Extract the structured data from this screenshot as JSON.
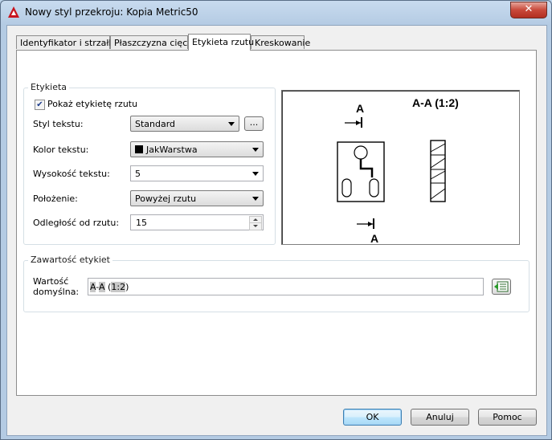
{
  "window": {
    "title": "Nowy styl przekroju: Kopia Metric50",
    "close_label": "✕"
  },
  "tabs": [
    {
      "label": "Identyfikator i strzałki"
    },
    {
      "label": "Płaszczyzna cięcia"
    },
    {
      "label": "Etykieta rzutu"
    },
    {
      "label": "Kreskowanie"
    }
  ],
  "active_tab": "Etykieta rzutu",
  "etykieta": {
    "group_label": "Etykieta",
    "show_label_checkbox": {
      "label": "Pokaż etykietę rzutu",
      "checked": true,
      "glyph": "✔"
    },
    "text_style": {
      "label": "Styl tekstu:",
      "value": "Standard",
      "browse_label": "..."
    },
    "text_color": {
      "label": "Kolor tekstu:",
      "value": "JakWarstwa",
      "swatch_color": "#000000"
    },
    "text_height": {
      "label": "Wysokość tekstu:",
      "value": "5"
    },
    "placement": {
      "label": "Położenie:",
      "value": "Powyżej rzutu"
    },
    "offset": {
      "label": "Odległość od rzutu:",
      "value": "15"
    }
  },
  "preview": {
    "view_label": "A-A (1:2)",
    "arrow_letter_top": "A",
    "arrow_letter_bottom": "A"
  },
  "contents": {
    "group_label": "Zawartość etykiet",
    "default_value_label_line1": "Wartość",
    "default_value_label_line2": "domyślna:",
    "default_value_parts": [
      "A",
      "-",
      "A",
      " (",
      "1:2",
      ")"
    ]
  },
  "buttons": {
    "ok": "OK",
    "cancel": "Anuluj",
    "help": "Pomoc"
  }
}
